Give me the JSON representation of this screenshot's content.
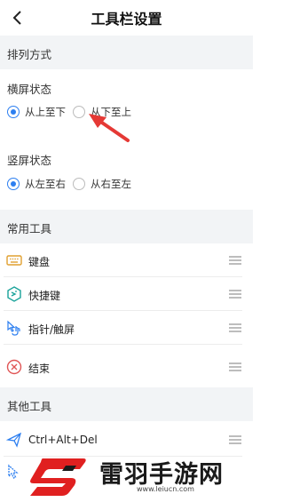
{
  "header": {
    "title": "工具栏设置"
  },
  "sections": {
    "arrangement": "排列方式",
    "common_tools": "常用工具",
    "other_tools": "其他工具"
  },
  "landscape": {
    "label": "横屏状态",
    "options": [
      "从上至下",
      "从下至上"
    ],
    "selected": "从上至下"
  },
  "portrait": {
    "label": "竖屏状态",
    "options": [
      "从左至右",
      "从右至左"
    ],
    "selected": "从左至右"
  },
  "common_tools": [
    {
      "label": "键盘",
      "icon": "keyboard-icon"
    },
    {
      "label": "快捷键",
      "icon": "shortcut-icon"
    },
    {
      "label": "指针/触屏",
      "icon": "pointer-touch-icon"
    },
    {
      "label": "结束",
      "icon": "end-icon"
    }
  ],
  "other_tools": [
    {
      "label": "Ctrl+Alt+Del",
      "icon": "send-icon"
    }
  ],
  "watermark": {
    "text": "雷羽手游网",
    "url": "www.leiucn.com"
  },
  "colors": {
    "accent": "#2d7ff0",
    "section_bg": "#f2f4f6",
    "annotation": "#e53935"
  }
}
